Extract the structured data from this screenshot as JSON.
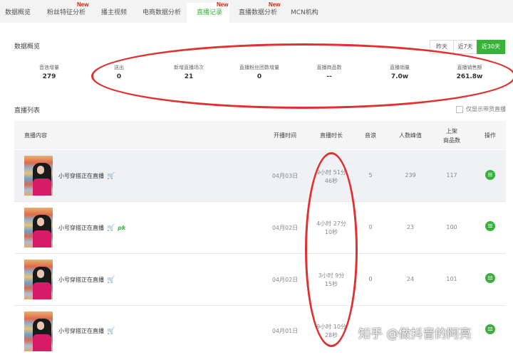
{
  "tabs": [
    {
      "label": "数据概览",
      "new": false
    },
    {
      "label": "粉丝特征分析",
      "new": true
    },
    {
      "label": "播主视频",
      "new": false
    },
    {
      "label": "电商数据分析",
      "new": false
    },
    {
      "label": "直播记录",
      "new": true,
      "active": true
    },
    {
      "label": "直播数据分析",
      "new": true
    },
    {
      "label": "MCN机构",
      "new": false
    }
  ],
  "new_label": "New",
  "overview": {
    "title": "数据概览",
    "ranges": [
      "昨天",
      "近7天",
      "近30天"
    ],
    "active_range": "近30天",
    "stats": [
      {
        "label": "音浪增量",
        "value": "279"
      },
      {
        "label": "送出",
        "value": "0"
      },
      {
        "label": "新增直播场次",
        "value": "21"
      },
      {
        "label": "直播粉丝团数增量",
        "value": "0"
      },
      {
        "label": "直播商品数",
        "value": "--"
      },
      {
        "label": "直播销量",
        "value": "7.0w"
      },
      {
        "label": "直播销售额",
        "value": "261.8w"
      }
    ]
  },
  "list": {
    "title": "直播列表",
    "filter_label": "仅显示带货直播",
    "columns": {
      "content": "直播内容",
      "start": "开播时间",
      "duration": "直播时长",
      "sound": "音浪",
      "peak": "人数峰值",
      "goods_1": "上架",
      "goods_2": "商品数",
      "op": "操作"
    },
    "rows": [
      {
        "title": "小号穿搭正在直播",
        "pk": false,
        "date": "04月03日",
        "duration_1": "9小时 51分",
        "duration_2": "46秒",
        "sound": "5",
        "peak": "239",
        "goods": "117"
      },
      {
        "title": "小号穿搭正在直播",
        "pk": true,
        "pk_label": "pk",
        "date": "04月02日",
        "duration_1": "4小时 27分",
        "duration_2": "10秒",
        "sound": "0",
        "peak": "23",
        "goods": "100"
      },
      {
        "title": "小号穿搭正在直播",
        "pk": false,
        "date": "04月02日",
        "duration_1": "3小时 9分",
        "duration_2": "15秒",
        "sound": "0",
        "peak": "24",
        "goods": "101"
      },
      {
        "title": "小号穿搭正在直播",
        "pk": false,
        "date": "04月01日",
        "duration_1": "9小时 10分",
        "duration_2": "28秒",
        "sound": "",
        "peak": "",
        "goods": ""
      }
    ]
  },
  "watermark": "知乎 @做抖音的阿亮",
  "colors": {
    "accent": "#3ab23a",
    "new_badge": "#d81e06",
    "annotation": "#e03030",
    "cart": "#e33333"
  }
}
